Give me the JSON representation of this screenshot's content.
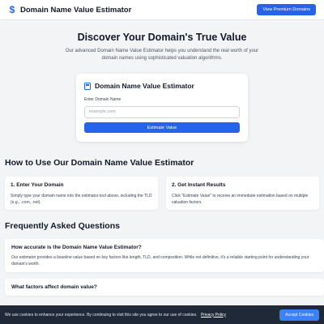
{
  "header": {
    "icon": "dollar-icon",
    "icon_glyph": "$",
    "title": "Domain Name Value Estimator",
    "premium_button": "View Premium Domains"
  },
  "hero": {
    "title": "Discover Your Domain's True Value",
    "subtitle": "Our advanced Domain Name Value Estimator helps you understand the real worth of your domain names using sophisticated valuation algorithms."
  },
  "estimator": {
    "icon": "calculator-icon",
    "title": "Domain Name Value Estimator",
    "input_label": "Enter Domain Name",
    "input_placeholder": "example.com",
    "input_value": "",
    "button": "Estimate Value"
  },
  "howto": {
    "title": "How to Use Our Domain Name Value Estimator",
    "steps": [
      {
        "title": "1. Enter Your Domain",
        "text": "Simply type your domain name into the estimator tool above, including the TLD (e.g., .com, .net)."
      },
      {
        "title": "2. Get Instant Results",
        "text": "Click \"Estimate Value\" to receive an immediate estimation based on multiple valuation factors."
      }
    ]
  },
  "faq": {
    "title": "Frequently Asked Questions",
    "items": [
      {
        "question": "How accurate is the Domain Name Value Estimator?",
        "answer": "Our estimator provides a baseline value based on key factors like length, TLD, and composition. While not definitive, it's a reliable starting point for understanding your domain's worth."
      },
      {
        "question": "What factors affect domain value?",
        "answer": ""
      }
    ]
  },
  "cookie": {
    "text": "We use cookies to enhance your experience. By continuing to visit this site you agree to our use of cookies.",
    "link": "Privacy Policy",
    "button": "Accept Cookies"
  },
  "colors": {
    "accent": "#2563eb",
    "background": "#f3f4f6",
    "cookie_bar": "#1f2937"
  }
}
